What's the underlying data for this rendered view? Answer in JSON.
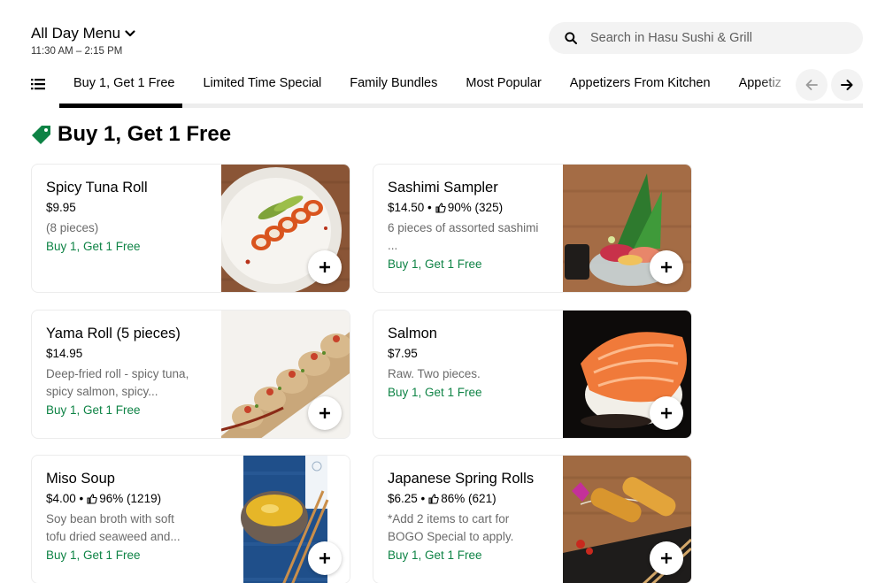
{
  "menu": {
    "title": "All Day Menu",
    "hours": "11:30 AM – 2:15 PM"
  },
  "search": {
    "placeholder": "Search in Hasu Sushi & Grill"
  },
  "tabs": [
    {
      "label": "Buy 1, Get 1 Free"
    },
    {
      "label": "Limited Time Special"
    },
    {
      "label": "Family Bundles"
    },
    {
      "label": "Most Popular"
    },
    {
      "label": "Appetizers From Kitchen"
    },
    {
      "label": "Appetiz"
    }
  ],
  "section": {
    "title": "Buy 1, Get 1 Free",
    "accent": "#0e8345"
  },
  "items": [
    {
      "name": "Spicy Tuna Roll",
      "price": "$9.95",
      "rating": "",
      "desc": "(8 pieces)",
      "promo": "Buy 1, Get 1 Free",
      "image": "spicy-tuna-roll-photo"
    },
    {
      "name": "Sashimi Sampler",
      "price": "$14.50",
      "rating": "90% (325)",
      "desc": "6 pieces of assorted sashimi\n...",
      "promo": "Buy 1, Get 1 Free",
      "image": "sashimi-sampler-photo"
    },
    {
      "name": "Yama Roll (5 pieces)",
      "price": "$14.95",
      "rating": "",
      "desc": "Deep-fried roll - spicy tuna,\nspicy salmon, spicy...",
      "promo": "Buy 1, Get 1 Free",
      "image": "yama-roll-photo"
    },
    {
      "name": "Salmon",
      "price": "$7.95",
      "rating": "",
      "desc": "Raw. Two pieces.",
      "promo": "Buy 1, Get 1 Free",
      "image": "salmon-nigiri-photo"
    },
    {
      "name": "Miso Soup",
      "price": "$4.00",
      "rating": "96% (1219)",
      "desc": "Soy bean broth with soft\ntofu dried seaweed and...",
      "promo": "Buy 1, Get 1 Free",
      "image": "miso-soup-photo"
    },
    {
      "name": "Japanese Spring Rolls",
      "price": "$6.25",
      "rating": "86% (621)",
      "desc": "*Add 2 items to cart for\nBOGO Special to apply.",
      "promo": "Buy 1, Get 1 Free",
      "image": "spring-rolls-photo"
    }
  ],
  "colors": {
    "promo_green": "#0e8345",
    "desc_gray": "#6b6b6b",
    "search_bg": "#f3f3f3"
  }
}
